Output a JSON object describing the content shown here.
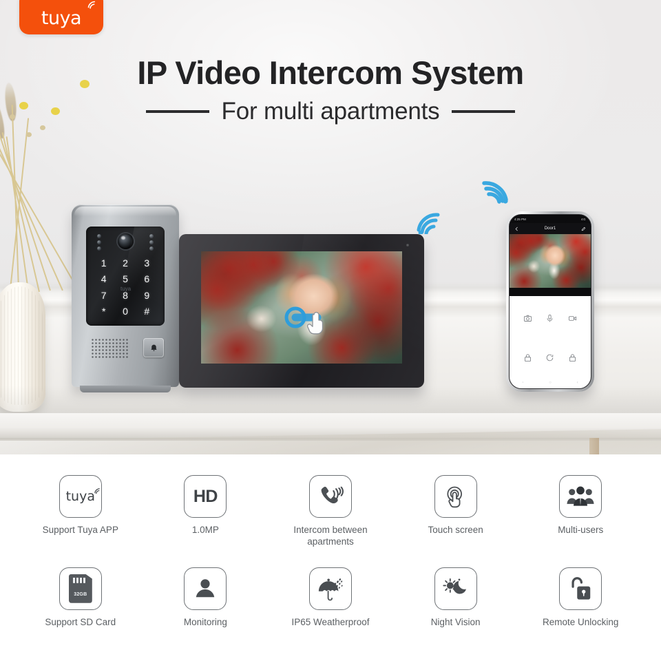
{
  "brand": {
    "name": "tuya",
    "badge_color": "#f4500c",
    "icon": "wifi-arc-icon"
  },
  "header": {
    "headline": "IP Video Intercom System",
    "subline": "For multi apartments"
  },
  "hero": {
    "scene_description": "door-station-monitor-phone-on-table",
    "wifi_icon_color": "#3aa8e0",
    "door_station": {
      "name": "door-station",
      "keypad": [
        "1",
        "2",
        "3",
        "4",
        "5",
        "6",
        "7",
        "8",
        "9",
        "*",
        "0",
        "#"
      ],
      "brand_mark": "tuya",
      "icons": [
        "camera-lens-icon",
        "ir-led-icon",
        "speaker-grille-icon",
        "doorbell-icon"
      ]
    },
    "monitor": {
      "name": "indoor-monitor",
      "icons": [
        "front-camera-icon",
        "touch-gesture-icon"
      ]
    },
    "phone": {
      "name": "smartphone-app",
      "status_time": "4:25 PM",
      "status_right": "4G",
      "app_title": "Door1",
      "back_icon": "arrow-left-icon",
      "edit_icon": "pencil-icon",
      "controls_row1": [
        {
          "label": "snapshot",
          "icon": "camera-icon"
        },
        {
          "label": "talk",
          "icon": "microphone-icon"
        },
        {
          "label": "record",
          "icon": "video-camera-icon"
        }
      ],
      "controls_row2": [
        {
          "label": "unlock-1",
          "icon": "lock-icon"
        },
        {
          "label": "switch-door",
          "icon": "refresh-icon"
        },
        {
          "label": "unlock-2",
          "icon": "lock-icon"
        }
      ],
      "nav_icons": [
        "recents-icon",
        "home-icon",
        "back-icon"
      ]
    }
  },
  "features": {
    "row1": [
      {
        "label": "Support Tuya APP",
        "icon": "tuya-logo-icon"
      },
      {
        "label": "1.0MP",
        "icon": "hd-icon",
        "badge_text": "HD"
      },
      {
        "label": "Intercom between apartments",
        "icon": "phone-ringing-icon"
      },
      {
        "label": "Touch screen",
        "icon": "touch-finger-icon"
      },
      {
        "label": "Multi-users",
        "icon": "users-group-icon"
      }
    ],
    "row2": [
      {
        "label": "Support SD Card",
        "icon": "sd-card-icon",
        "badge_text": "32GB"
      },
      {
        "label": "Monitoring",
        "icon": "person-icon"
      },
      {
        "label": "IP65 Weatherproof",
        "icon": "umbrella-rain-icon"
      },
      {
        "label": "Night Vision",
        "icon": "sun-moon-icon"
      },
      {
        "label": "Remote Unlocking",
        "icon": "unlock-icon"
      }
    ]
  }
}
